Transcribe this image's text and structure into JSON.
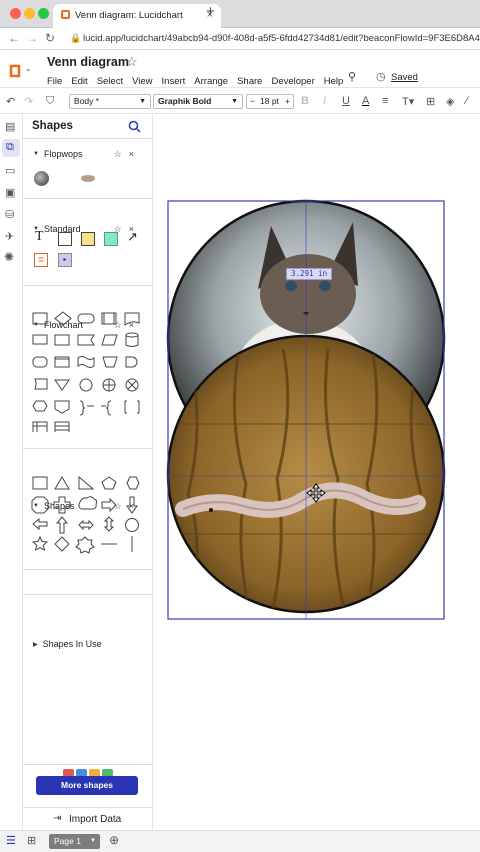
{
  "browser": {
    "tab_title": "Venn diagram: Lucidchart",
    "url": "lucid.app/lucidchart/49abcb94-d90f-408d-a5f5-6fdd42734d81/edit?beaconFlowId=9F3E6D8A49..."
  },
  "app": {
    "doc_title": "Venn diagram",
    "menu": [
      "File",
      "Edit",
      "Select",
      "View",
      "Insert",
      "Arrange",
      "Share",
      "Developer",
      "Help"
    ],
    "saved_label": "Saved"
  },
  "toolbar": {
    "style_value": "Body *",
    "font_value": "Graphik Bold",
    "font_size": "18 pt",
    "decrease": "−",
    "increase": "+"
  },
  "panel": {
    "title": "Shapes",
    "sections": {
      "flopwops": "Flopwops",
      "standard": "Standard",
      "flowchart": "Flowchart",
      "shapes": "Shapes",
      "in_use": "Shapes In Use"
    },
    "more_shapes": "More shapes",
    "import_data": "Import Data"
  },
  "canvas": {
    "measure_label": "3.291 in"
  },
  "bottom": {
    "page_tab": "Page 1"
  },
  "colors": {
    "accent": "#2a35b3",
    "selection": "#3c3cb4"
  }
}
